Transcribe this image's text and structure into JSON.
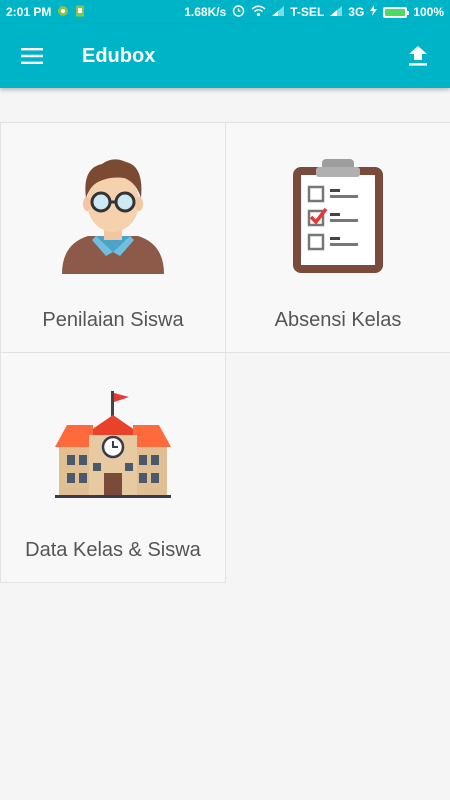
{
  "status": {
    "time": "2:01 PM",
    "speed": "1.68K/s",
    "carrier": "T-SEL",
    "network": "3G",
    "battery": "100%",
    "battery_level": 1.0
  },
  "appbar": {
    "title": "Edubox",
    "menu_icon": "hamburger-menu-icon",
    "upload_icon": "upload-icon"
  },
  "tiles": [
    {
      "label": "Penilaian Siswa",
      "icon": "teacher-icon"
    },
    {
      "label": "Absensi Kelas",
      "icon": "clipboard-checklist-icon"
    },
    {
      "label": "Data Kelas & Siswa",
      "icon": "school-building-icon"
    }
  ],
  "colors": {
    "primary": "#00b4c8",
    "background": "#f5f5f5",
    "tile": "#f8f8f8",
    "label": "#555555"
  }
}
